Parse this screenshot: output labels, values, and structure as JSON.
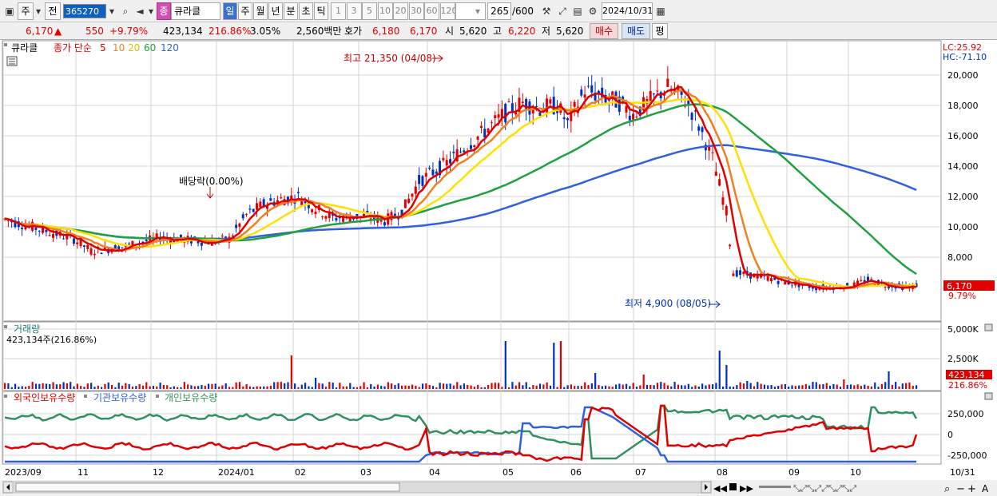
{
  "toolbar": {
    "type_label": "주",
    "period_label": "전",
    "code": "365270",
    "stock_type": "종",
    "stock_name": "큐라클",
    "periods": [
      "일",
      "주",
      "월",
      "년",
      "분",
      "초",
      "틱"
    ],
    "minutes": [
      "1",
      "3",
      "5",
      "10",
      "20",
      "30",
      "60",
      "120"
    ],
    "count": "265",
    "count_total": "/600",
    "date": "2024/10/31"
  },
  "quote": {
    "price": "6,170",
    "change": "550",
    "change_pct": "+9.79%",
    "volume": "423,134",
    "volume_ratio": "216.86%",
    "turnover": "3.05%",
    "trade_value": "2,560백만",
    "hoga_label": "호가",
    "ask": "6,180",
    "bid": "6,170",
    "open_label": "시",
    "open": "5,620",
    "high_label": "고",
    "high": "6,220",
    "low_label": "저",
    "low": "5,620",
    "buy_label": "매수",
    "sell_label": "매도",
    "eval_label": "평"
  },
  "price_panel": {
    "name": "큐라클",
    "ma_prefix": "종가 단순",
    "ma": [
      "5",
      "10",
      "20",
      "60",
      "120"
    ],
    "lc": "LC:25.92",
    "hc": "HC:-71.10",
    "y_ticks": [
      "20,000",
      "18,000",
      "16,000",
      "14,000",
      "12,000",
      "10,000",
      "8,000"
    ],
    "current_price": "6,170",
    "current_pct": "9.79%",
    "high_note": "최고 21,350 (04/08)",
    "low_note": "최저 4,900 (08/05)",
    "dividend_note": "배당락(0.00%)"
  },
  "volume_panel": {
    "title": "거래량",
    "info": "423,134주(216.86%)",
    "y_ticks": [
      "5,000K",
      "2,500K"
    ],
    "current": "423,134",
    "current_pct": "216.86%"
  },
  "holding_panel": {
    "labels": [
      "외국인보유수량",
      "기관보유수량",
      "개인보유수량"
    ],
    "y_ticks": [
      "250,000",
      "0",
      "-250,000"
    ]
  },
  "x_axis": {
    "labels": [
      "2023/09",
      "11",
      "12",
      "2024/01",
      "02",
      "03",
      "04",
      "05",
      "06",
      "07",
      "08",
      "09",
      "10",
      "10/31"
    ]
  },
  "colors": {
    "ma5": "#e00000",
    "ma10": "#f08020",
    "ma20": "#ffe000",
    "ma60": "#20a040",
    "ma120": "#3060e0",
    "up": "#e00000",
    "down": "#0030c0",
    "foreign": "#e00000",
    "inst": "#3060e0",
    "indiv": "#309060"
  }
}
